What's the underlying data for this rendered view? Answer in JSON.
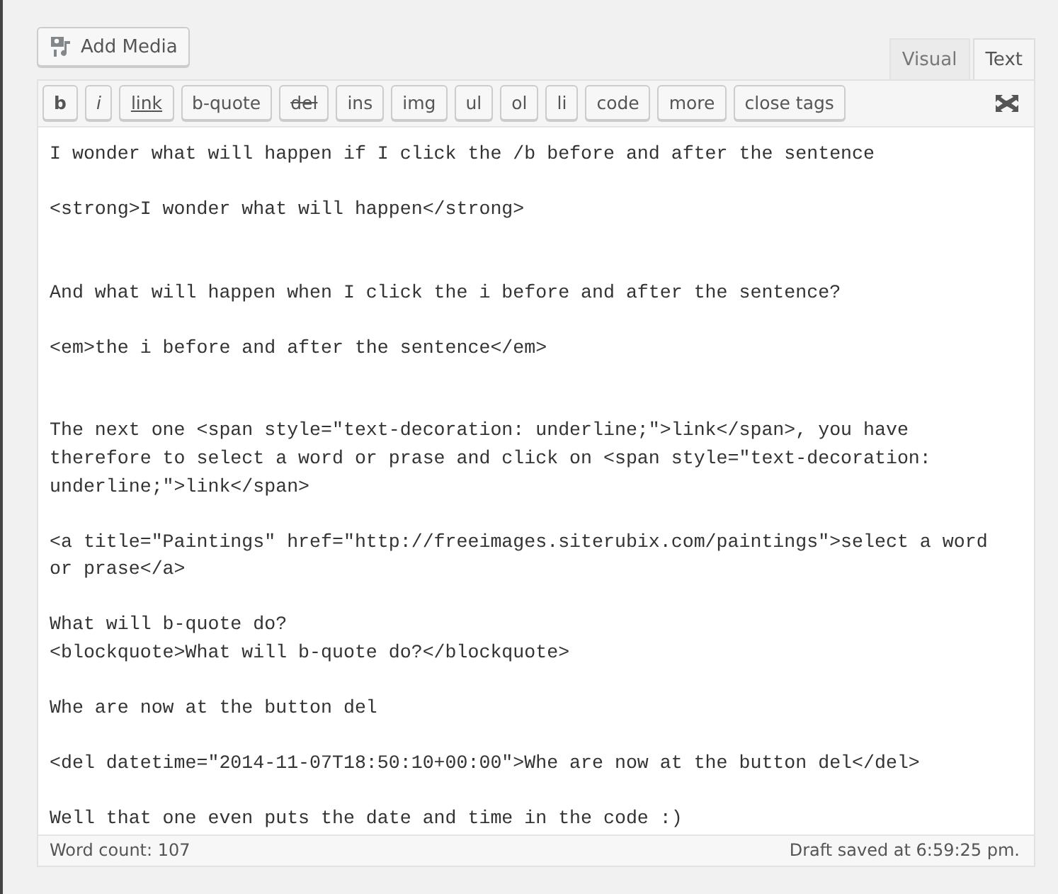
{
  "media_button": {
    "label": "Add Media"
  },
  "tabs": [
    {
      "label": "Visual",
      "selected": false
    },
    {
      "label": "Text",
      "selected": true
    }
  ],
  "toolbar": [
    {
      "label": "b",
      "kind": "bold"
    },
    {
      "label": "i",
      "kind": "italic"
    },
    {
      "label": "link",
      "kind": "underline"
    },
    {
      "label": "b-quote",
      "kind": "plain"
    },
    {
      "label": "del",
      "kind": "strike"
    },
    {
      "label": "ins",
      "kind": "plain"
    },
    {
      "label": "img",
      "kind": "plain"
    },
    {
      "label": "ul",
      "kind": "plain"
    },
    {
      "label": "ol",
      "kind": "plain"
    },
    {
      "label": "li",
      "kind": "plain"
    },
    {
      "label": "code",
      "kind": "plain"
    },
    {
      "label": "more",
      "kind": "plain"
    },
    {
      "label": "close tags",
      "kind": "plain"
    }
  ],
  "editor": {
    "content": "I wonder what will happen if I click the /b before and after the sentence\n\n<strong>I wonder what will happen</strong>\n\n\nAnd what will happen when I click the i before and after the sentence?\n\n<em>the i before and after the sentence</em>\n\n\nThe next one <span style=\"text-decoration: underline;\">link</span>, you have\ntherefore to select a word or prase and click on <span style=\"text-decoration:\nunderline;\">link</span>\n\n<a title=\"Paintings\" href=\"http://freeimages.siterubix.com/paintings\">select a word\nor prase</a>\n\nWhat will b-quote do?\n<blockquote>What will b-quote do?</blockquote>\n\nWhe are now at the button del\n\n<del datetime=\"2014-11-07T18:50:10+00:00\">Whe are now at the button del</del>\n\nWell that one even puts the date and time in the code :)"
  },
  "status_bar": {
    "word_count": "Word count: 107",
    "draft_status": "Draft saved at 6:59:25 pm."
  }
}
